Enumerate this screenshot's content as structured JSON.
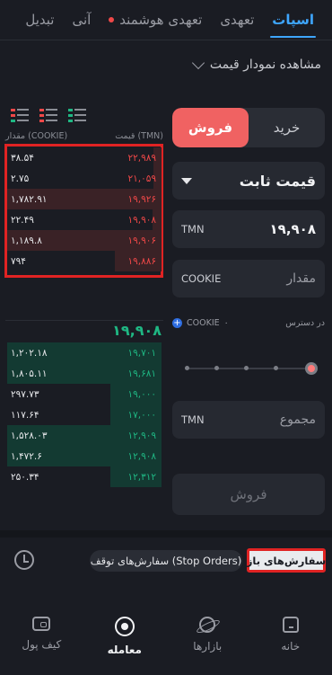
{
  "tabs": [
    {
      "label": "اسپات",
      "active": true
    },
    {
      "label": "تعهدی",
      "active": false
    },
    {
      "label": "تعهدی هوشمند",
      "active": false,
      "dot": true
    },
    {
      "label": "آنی",
      "active": false
    },
    {
      "label": "تبدیل",
      "active": false
    }
  ],
  "chart_toggle": {
    "label": "مشاهده نمودار قیمت"
  },
  "order_book": {
    "price_header": "قیمت (TMN)",
    "amount_header": "مقدار (COOKIE)",
    "sell_rows": [
      {
        "price": "۲۲,۹۸۹",
        "amount": "۳۸.۵۴",
        "depth": 0.05
      },
      {
        "price": "۲۱,۰۵۹",
        "amount": "۲.۷۵",
        "depth": 0.05
      },
      {
        "price": "۱۹,۹۲۶",
        "amount": "۱,۷۸۲.۹۱",
        "depth": 1.0
      },
      {
        "price": "۱۹,۹۰۸",
        "amount": "۲۲.۴۹",
        "depth": 0.06
      },
      {
        "price": "۱۹,۹۰۶",
        "amount": "۱,۱۸۹.۸",
        "depth": 1.0
      },
      {
        "price": "۱۹,۸۸۶",
        "amount": "۷۹۴",
        "depth": 0.3
      }
    ],
    "last_price": "۱۹,۹۰۸",
    "buy_rows": [
      {
        "price": "۱۹,۷۰۱",
        "amount": "۱,۲۰۲.۱۸",
        "depth": 1.0
      },
      {
        "price": "۱۹,۶۸۱",
        "amount": "۱,۸۰۵.۱۱",
        "depth": 1.0
      },
      {
        "price": "۱۹,۰۰۰",
        "amount": "۲۹۷.۷۳",
        "depth": 0.33
      },
      {
        "price": "۱۷,۰۰۰",
        "amount": "۱۱۷.۶۴",
        "depth": 0.33
      },
      {
        "price": "۱۲,۹۰۹",
        "amount": "۱,۵۲۸.۰۳",
        "depth": 1.0
      },
      {
        "price": "۱۲,۹۰۸",
        "amount": "۱,۴۷۲.۶",
        "depth": 1.0
      },
      {
        "price": "۱۲,۳۱۲",
        "amount": "۲۵۰.۳۴",
        "depth": 0.33
      }
    ]
  },
  "trade_form": {
    "buy_label": "خرید",
    "sell_label": "فروش",
    "order_type": "قیمت ثابت",
    "price_unit": "TMN",
    "price_value": "۱۹,۹۰۸",
    "amount_placeholder": "مقدار",
    "amount_unit": "COOKIE",
    "available_label": "در دسترس",
    "available_currency": "COOKIE",
    "available_value": "۰",
    "slider_value": 1.0,
    "total_placeholder": "مجموع",
    "total_unit": "TMN",
    "submit_label": "فروش"
  },
  "orders_bar": {
    "open_orders": "سفارش‌های باز",
    "stop_orders": "سفارش‌های توقف (Stop Orders)"
  },
  "bottom_nav": [
    {
      "label": "خانه",
      "icon": "home-icon"
    },
    {
      "label": "بازارها",
      "icon": "markets-icon"
    },
    {
      "label": "معامله",
      "icon": "trade-icon",
      "active": true
    },
    {
      "label": "کیف پول",
      "icon": "wallet-icon"
    }
  ],
  "colors": {
    "background": "#1a1c23",
    "accent_blue": "#3ea6ff",
    "sell_red": "#f04848",
    "buy_green": "#1fb783",
    "sell_button": "#f06262",
    "highlight_box": "#e02323"
  }
}
